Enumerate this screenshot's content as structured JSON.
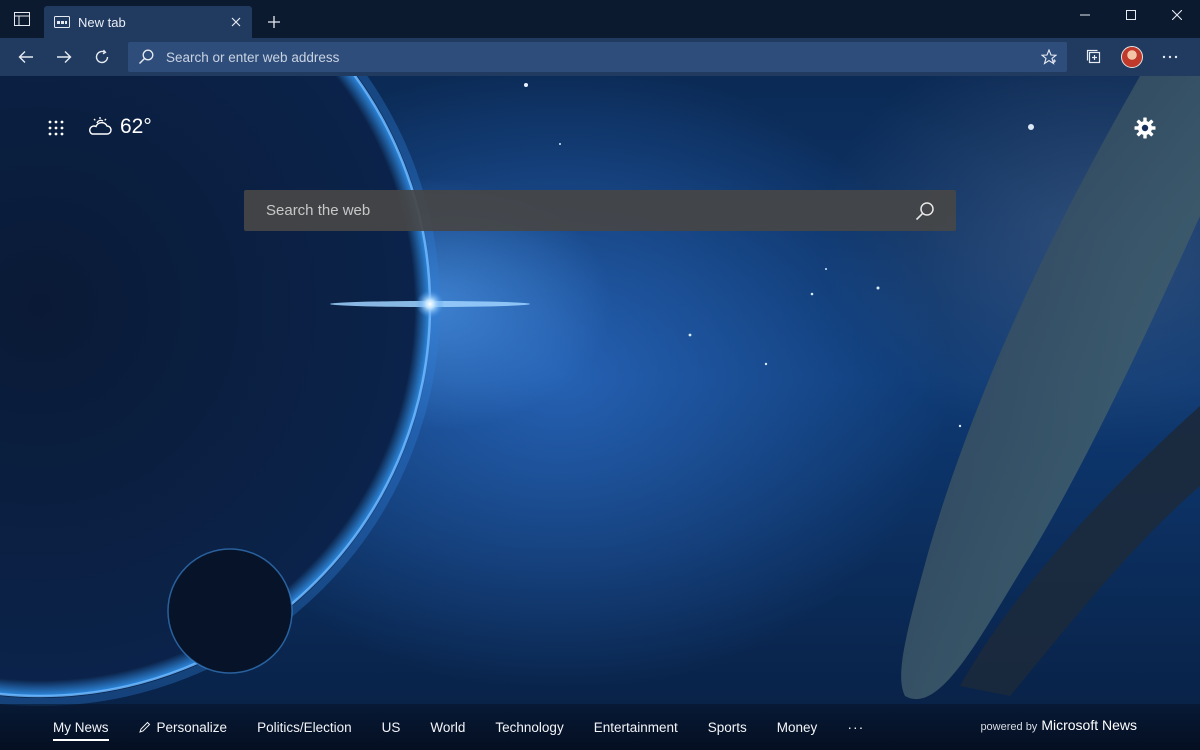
{
  "tab": {
    "title": "New tab"
  },
  "address_bar": {
    "placeholder": "Search or enter web address"
  },
  "weather": {
    "temperature": "62°"
  },
  "search": {
    "placeholder": "Search the web"
  },
  "news_bar": {
    "items": [
      "My News",
      "Personalize",
      "Politics/Election",
      "US",
      "World",
      "Technology",
      "Entertainment",
      "Sports",
      "Money"
    ],
    "more": "···",
    "powered_by": "powered by",
    "brand": "Microsoft News"
  },
  "colors": {
    "titlebar": "#0c1a30",
    "toolbar": "#203a60",
    "addressbar": "#2f4d7b",
    "search_box": "#464646"
  }
}
